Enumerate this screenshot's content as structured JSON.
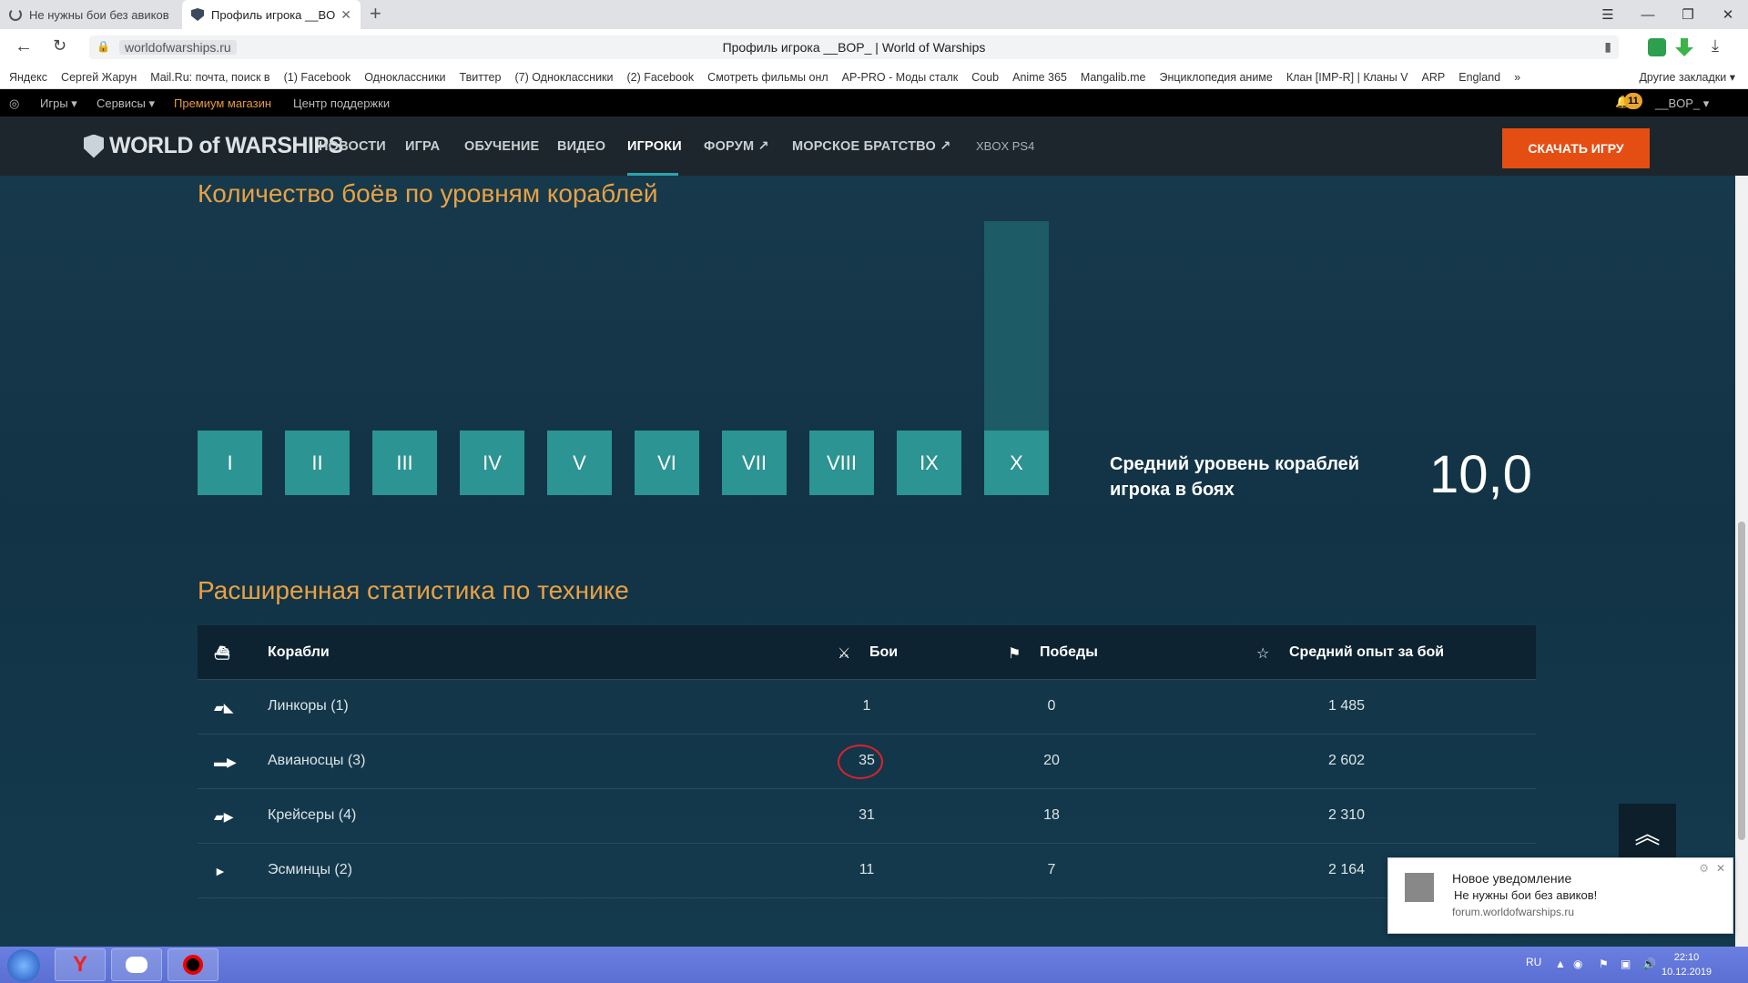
{
  "browser": {
    "tabs": [
      {
        "title": "Не нужны бои без авиков"
      },
      {
        "title": "Профиль игрока __BOP_"
      }
    ],
    "new_tab": "+",
    "url_domain": "worldofwarships.ru",
    "page_title": "Профиль игрока __BOP_ | World of Warships",
    "bookmarks": [
      "Яндекс",
      "Сергей Жарун",
      "Mail.Ru: почта, поиск в",
      "(1) Facebook",
      "Одноклассники",
      "Твиттер",
      "(7) Одноклассники",
      "(2) Facebook",
      "Смотреть фильмы онл",
      "AP-PRO - Моды сталк",
      "Coub",
      "Anime 365",
      "Mangalib.me",
      "Энциклопедия аниме",
      "Клан [IMP-R] | Кланы V",
      "ARP",
      "England"
    ],
    "bookmarks_more": "»",
    "other_bookmarks": "Другие закладки ▾"
  },
  "topbar": {
    "games": "Игры",
    "services": "Сервисы",
    "premium": "Премиум магазин",
    "support": "Центр поддержки",
    "notif_count": "11",
    "username": "__BOP_"
  },
  "sitenav": {
    "logo": "WORLD of WARSHIPS",
    "items": [
      "НОВОСТИ",
      "ИГРА",
      "ОБУЧЕНИЕ",
      "ВИДЕО",
      "ИГРОКИ",
      "ФОРУМ",
      "МОРСКОЕ БРАТСТВО"
    ],
    "platforms": "XBOX  PS4",
    "download": "СКАЧАТЬ ИГРУ"
  },
  "tier_chart": {
    "title": "Количество боёв по уровням кораблей",
    "avg_label": "Средний уровень кораблей игрока в боях",
    "avg_value": "10,0"
  },
  "chart_data": {
    "type": "bar",
    "title": "Количество боёв по уровням кораблей",
    "categories": [
      "I",
      "II",
      "III",
      "IV",
      "V",
      "VI",
      "VII",
      "VIII",
      "IX",
      "X"
    ],
    "values": [
      0,
      0,
      0,
      0,
      0,
      0,
      0,
      0,
      0,
      1
    ],
    "ylim": [
      0,
      1
    ]
  },
  "stats_table": {
    "title": "Расширенная статистика по технике",
    "headers": {
      "ships": "Корабли",
      "battles": "Бои",
      "wins": "Победы",
      "avg_xp": "Средний опыт за бой"
    },
    "rows": [
      {
        "name": "Линкоры (1)",
        "battles": "1",
        "wins": "0",
        "avg_xp": "1 485"
      },
      {
        "name": "Авианосцы (3)",
        "battles": "35",
        "wins": "20",
        "avg_xp": "2 602"
      },
      {
        "name": "Крейсеры (4)",
        "battles": "31",
        "wins": "18",
        "avg_xp": "2 310"
      },
      {
        "name": "Эсминцы (2)",
        "battles": "11",
        "wins": "7",
        "avg_xp": "2 164"
      }
    ]
  },
  "notification": {
    "title": "Новое уведомление",
    "text": "Не нужны бои без авиков!",
    "source": "forum.worldofwarships.ru"
  },
  "taskbar": {
    "lang": "RU",
    "time": "22:10",
    "date": "10.12.2019"
  }
}
